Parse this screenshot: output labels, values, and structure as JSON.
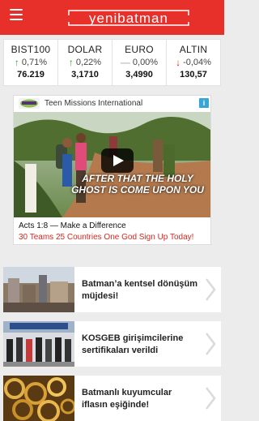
{
  "header": {
    "logo_text": "yenibatman",
    "menu_icon": "hamburger-icon"
  },
  "ticker": [
    {
      "name": "BIST100",
      "change": "0,71%",
      "value": "76.219",
      "dir": "up"
    },
    {
      "name": "DOLAR",
      "change": "0,22%",
      "value": "3,1710",
      "dir": "up"
    },
    {
      "name": "EURO",
      "change": "0,00%",
      "value": "3,4990",
      "dir": "flat"
    },
    {
      "name": "ALTIN",
      "change": "-0,04%",
      "value": "130,57",
      "dir": "down"
    }
  ],
  "ad": {
    "brand": "Teen Missions International",
    "overlay_text": "AFTER THAT THE HOLY GHOST IS COME UPON YOU",
    "title": "Acts 1:8 — Make a Difference",
    "subtitle": "30 Teams 25 Countries One God Sign Up Today!",
    "info_icon": "ad-info-icon",
    "play_icon": "play-icon"
  },
  "news": [
    {
      "title": "Batman’a kentsel dönüşüm müjdesi!"
    },
    {
      "title": "KOSGEB girişimcilerine sertifikaları verildi"
    },
    {
      "title": "Batmanlı kuyumcular iflasın eşiğinde!"
    }
  ],
  "colors": {
    "brand_red": "#e8302a",
    "up_green": "#2e9e3a",
    "down_red": "#d9261c",
    "flat_grey": "#bdbdbd"
  }
}
